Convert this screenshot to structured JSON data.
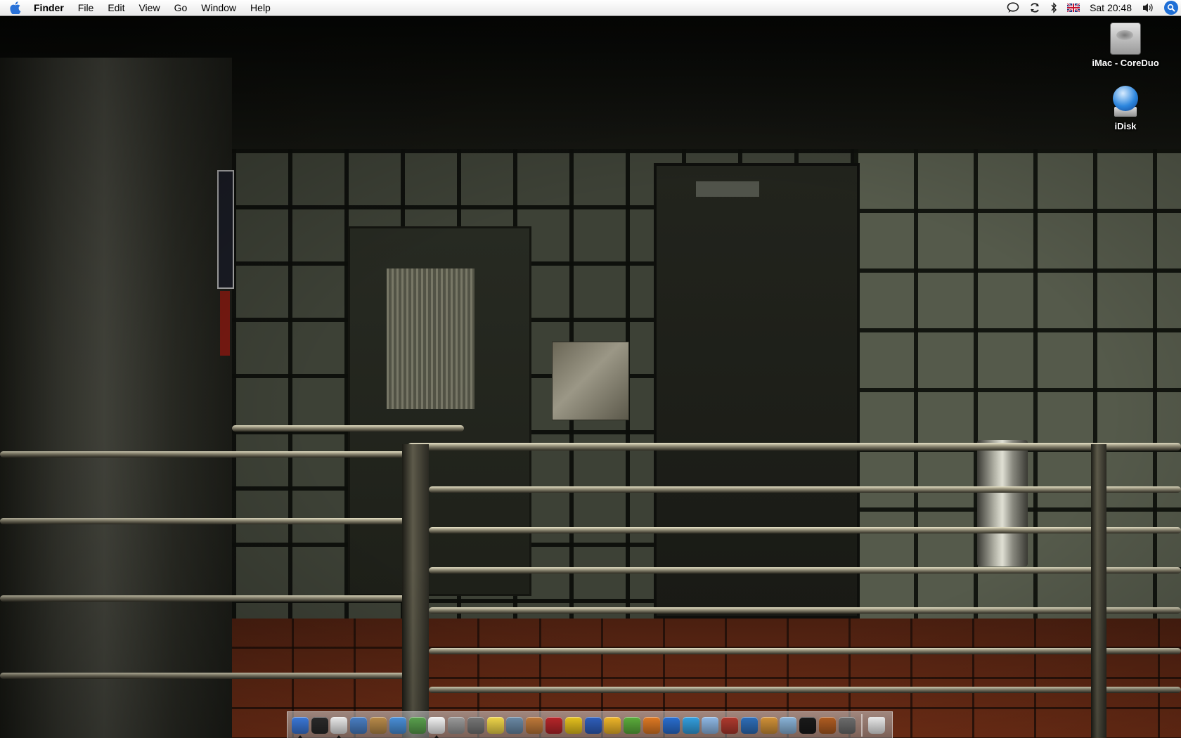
{
  "menubar": {
    "apple_icon": "apple-icon",
    "app_name": "Finder",
    "menus": [
      "File",
      "Edit",
      "View",
      "Go",
      "Window",
      "Help"
    ],
    "status": {
      "icons": [
        "ichat-status-icon",
        "sync-icon",
        "bluetooth-icon",
        "uk-flag-input-icon"
      ],
      "clock": "Sat 20:48",
      "volume_icon": "volume-icon",
      "spotlight_icon": "spotlight-search-icon"
    }
  },
  "desktop": {
    "icons": [
      {
        "label": "iMac - CoreDuo",
        "icon": "hard-drive-icon"
      },
      {
        "label": "iDisk",
        "icon": "idisk-icon"
      }
    ]
  },
  "dock": {
    "apps": [
      {
        "name": "finder-icon",
        "color": "#3b78d8",
        "running": true
      },
      {
        "name": "dashboard-icon",
        "color": "#2a2a2a",
        "running": false
      },
      {
        "name": "ichat-icon",
        "color": "#e9e9e9",
        "running": true
      },
      {
        "name": "preview-icon",
        "color": "#4a7fc4",
        "running": false
      },
      {
        "name": "address-book-icon",
        "color": "#b98b4a",
        "running": false
      },
      {
        "name": "safari-icon",
        "color": "#4a90d9",
        "running": false
      },
      {
        "name": "itunes-icon",
        "color": "#5aa14e",
        "running": false
      },
      {
        "name": "ical-icon",
        "color": "#f3f3f3",
        "running": true
      },
      {
        "name": "system-preferences-icon",
        "color": "#9a9a9a",
        "running": false
      },
      {
        "name": "calculator-icon",
        "color": "#777777",
        "running": false
      },
      {
        "name": "stickies-icon",
        "color": "#f0d64a",
        "running": false
      },
      {
        "name": "iphoto-icon",
        "color": "#6b8aa6",
        "running": false
      },
      {
        "name": "image-capture-icon",
        "color": "#c07a3a",
        "running": false
      },
      {
        "name": "photo-booth-icon",
        "color": "#b8262a",
        "running": false
      },
      {
        "name": "console-warning-icon",
        "color": "#e6c21e",
        "running": false
      },
      {
        "name": "xcode-hammer-icon",
        "color": "#2f5fbd",
        "running": false
      },
      {
        "name": "cashflow-icon",
        "color": "#f0b72a",
        "running": false
      },
      {
        "name": "spss-icon",
        "color": "#5cae3c",
        "running": false
      },
      {
        "name": "powerpoint-icon",
        "color": "#e07a24",
        "running": false
      },
      {
        "name": "word-icon",
        "color": "#2a6fd1",
        "running": false
      },
      {
        "name": "skype-icon",
        "color": "#34a0e0",
        "running": false
      },
      {
        "name": "box-icon",
        "color": "#8fb9e6",
        "running": false
      },
      {
        "name": "dictionary-icon",
        "color": "#b03a2e",
        "running": false
      },
      {
        "name": "google-earth-icon",
        "color": "#2f6fba",
        "running": false
      },
      {
        "name": "cyberduck-icon",
        "color": "#d29238",
        "running": false
      },
      {
        "name": "network-icon",
        "color": "#8ab4d9",
        "running": false
      },
      {
        "name": "terminal-icon",
        "color": "#1a1a1a",
        "running": false
      },
      {
        "name": "disk-utility-icon",
        "color": "#b05d22",
        "running": false
      },
      {
        "name": "automator-icon",
        "color": "#6d6d6d",
        "running": false
      }
    ],
    "trash_icon": "trash-icon"
  }
}
